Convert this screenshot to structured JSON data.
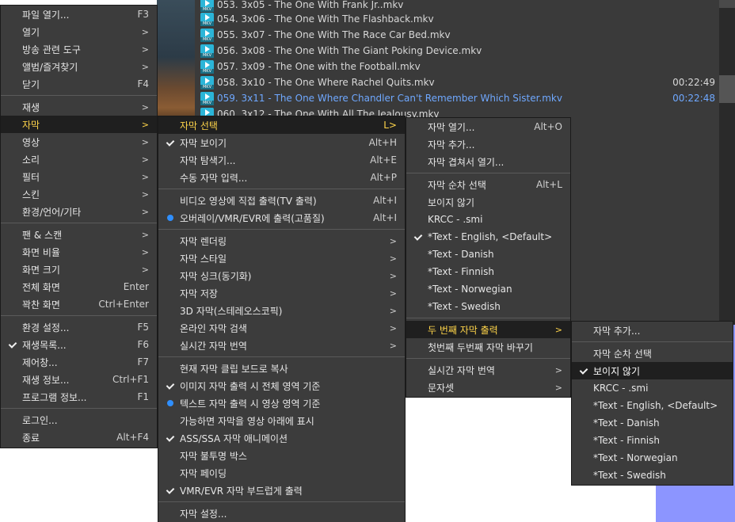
{
  "playlist": {
    "items": [
      {
        "title": "053. 3x05 - The One With Frank Jr..mkv",
        "duration": ""
      },
      {
        "title": "054. 3x06 - The One With The Flashback.mkv",
        "duration": ""
      },
      {
        "title": "055. 3x07 - The One With The Race Car Bed.mkv",
        "duration": ""
      },
      {
        "title": "056. 3x08 - The One With The Giant Poking Device.mkv",
        "duration": ""
      },
      {
        "title": "057. 3x09 - The One with the Football.mkv",
        "duration": ""
      },
      {
        "title": "058. 3x10 - The One Where Rachel Quits.mkv",
        "duration": "00:22:49"
      },
      {
        "title": "059. 3x11 - The One Where Chandler Can't Remember Which Sister.mkv",
        "duration": "00:22:48"
      },
      {
        "title": "060. 3x12 - The One With All The Jealousy.mkv",
        "duration": ""
      }
    ]
  },
  "main_menu": {
    "items": [
      {
        "label": "파일 열기...",
        "shortcut": "F3",
        "arrow": ""
      },
      {
        "label": "열기",
        "shortcut": "",
        "arrow": ">"
      },
      {
        "label": "방송 관련 도구",
        "shortcut": "",
        "arrow": ">"
      },
      {
        "label": "앨범/즐겨찾기",
        "shortcut": "",
        "arrow": ">"
      },
      {
        "label": "닫기",
        "shortcut": "F4",
        "arrow": ""
      },
      {
        "label": "재생",
        "shortcut": "",
        "arrow": ">"
      },
      {
        "label": "자막",
        "shortcut": "",
        "arrow": ">"
      },
      {
        "label": "영상",
        "shortcut": "",
        "arrow": ">"
      },
      {
        "label": "소리",
        "shortcut": "",
        "arrow": ">"
      },
      {
        "label": "필터",
        "shortcut": "",
        "arrow": ">"
      },
      {
        "label": "스킨",
        "shortcut": "",
        "arrow": ">"
      },
      {
        "label": "환경/언어/기타",
        "shortcut": "",
        "arrow": ">"
      },
      {
        "label": "팬 & 스캔",
        "shortcut": "",
        "arrow": ">"
      },
      {
        "label": "화면 비율",
        "shortcut": "",
        "arrow": ">"
      },
      {
        "label": "화면 크기",
        "shortcut": "",
        "arrow": ">"
      },
      {
        "label": "전체 화면",
        "shortcut": "Enter",
        "arrow": ""
      },
      {
        "label": "꽉찬 화면",
        "shortcut": "Ctrl+Enter",
        "arrow": ""
      },
      {
        "label": "환경 설정...",
        "shortcut": "F5",
        "arrow": ""
      },
      {
        "label": "재생목록...",
        "shortcut": "F6",
        "arrow": ""
      },
      {
        "label": "제어창...",
        "shortcut": "F7",
        "arrow": ""
      },
      {
        "label": "재생 정보...",
        "shortcut": "Ctrl+F1",
        "arrow": ""
      },
      {
        "label": "프로그램 정보...",
        "shortcut": "F1",
        "arrow": ""
      },
      {
        "label": "로그인...",
        "shortcut": "",
        "arrow": ""
      },
      {
        "label": "종료",
        "shortcut": "Alt+F4",
        "arrow": ""
      }
    ]
  },
  "subtitle_menu": {
    "items": [
      {
        "label": "자막 선택",
        "shortcut": "L>",
        "arrow": ""
      },
      {
        "label": "자막 보이기",
        "shortcut": "Alt+H",
        "arrow": ""
      },
      {
        "label": "자막 탐색기...",
        "shortcut": "Alt+E",
        "arrow": ""
      },
      {
        "label": "수동 자막 입력...",
        "shortcut": "Alt+P",
        "arrow": ""
      },
      {
        "label": "비디오 영상에 직접 출력(TV 출력)",
        "shortcut": "Alt+I",
        "arrow": ""
      },
      {
        "label": "오버레이/VMR/EVR에 출력(고품질)",
        "shortcut": "Alt+I",
        "arrow": ""
      },
      {
        "label": "자막 렌더링",
        "shortcut": "",
        "arrow": ">"
      },
      {
        "label": "자막 스타일",
        "shortcut": "",
        "arrow": ">"
      },
      {
        "label": "자막 싱크(동기화)",
        "shortcut": "",
        "arrow": ">"
      },
      {
        "label": "자막 저장",
        "shortcut": "",
        "arrow": ">"
      },
      {
        "label": "3D 자막(스테레오스코픽)",
        "shortcut": "",
        "arrow": ">"
      },
      {
        "label": "온라인 자막 검색",
        "shortcut": "",
        "arrow": ">"
      },
      {
        "label": "실시간 자막 번역",
        "shortcut": "",
        "arrow": ">"
      },
      {
        "label": "현재 자막 클립 보드로 복사",
        "shortcut": "",
        "arrow": ""
      },
      {
        "label": "이미지 자막 출력 시 전체 영역 기준",
        "shortcut": "",
        "arrow": ""
      },
      {
        "label": "텍스트 자막 출력 시 영상 영역 기준",
        "shortcut": "",
        "arrow": ""
      },
      {
        "label": "가능하면 자막을 영상 아래에 표시",
        "shortcut": "",
        "arrow": ""
      },
      {
        "label": "ASS/SSA 자막 애니메이션",
        "shortcut": "",
        "arrow": ""
      },
      {
        "label": "자막 불투명 박스",
        "shortcut": "",
        "arrow": ""
      },
      {
        "label": "자막 페이딩",
        "shortcut": "",
        "arrow": ""
      },
      {
        "label": "VMR/EVR 자막 부드럽게 출력",
        "shortcut": "",
        "arrow": ""
      },
      {
        "label": "자막 설정...",
        "shortcut": "",
        "arrow": ""
      }
    ]
  },
  "select_menu": {
    "items": [
      {
        "label": "자막 열기...",
        "shortcut": "Alt+O",
        "arrow": ""
      },
      {
        "label": "자막 추가...",
        "shortcut": "",
        "arrow": ""
      },
      {
        "label": "자막 겹쳐서 열기...",
        "shortcut": "",
        "arrow": ""
      },
      {
        "label": "자막 순차 선택",
        "shortcut": "Alt+L",
        "arrow": ""
      },
      {
        "label": "보이지 않기",
        "shortcut": "",
        "arrow": ""
      },
      {
        "label": "KRCC - .smi",
        "shortcut": "",
        "arrow": ""
      },
      {
        "label": "*Text - English, <Default>",
        "shortcut": "",
        "arrow": ""
      },
      {
        "label": "*Text - Danish",
        "shortcut": "",
        "arrow": ""
      },
      {
        "label": "*Text - Finnish",
        "shortcut": "",
        "arrow": ""
      },
      {
        "label": "*Text - Norwegian",
        "shortcut": "",
        "arrow": ""
      },
      {
        "label": "*Text - Swedish",
        "shortcut": "",
        "arrow": ""
      },
      {
        "label": "두 번째 자막 출력",
        "shortcut": "",
        "arrow": ">"
      },
      {
        "label": "첫번째 두번째 자막 바꾸기",
        "shortcut": "",
        "arrow": ""
      },
      {
        "label": "실시간 자막 번역",
        "shortcut": "",
        "arrow": ">"
      },
      {
        "label": "문자셋",
        "shortcut": "",
        "arrow": ">"
      }
    ]
  },
  "second_menu": {
    "items": [
      {
        "label": "자막 추가..."
      },
      {
        "label": "자막 순차 선택"
      },
      {
        "label": "보이지 않기"
      },
      {
        "label": "KRCC - .smi"
      },
      {
        "label": "*Text - English, <Default>"
      },
      {
        "label": "*Text - Danish"
      },
      {
        "label": "*Text - Finnish"
      },
      {
        "label": "*Text - Norwegian"
      },
      {
        "label": "*Text - Swedish"
      }
    ]
  }
}
